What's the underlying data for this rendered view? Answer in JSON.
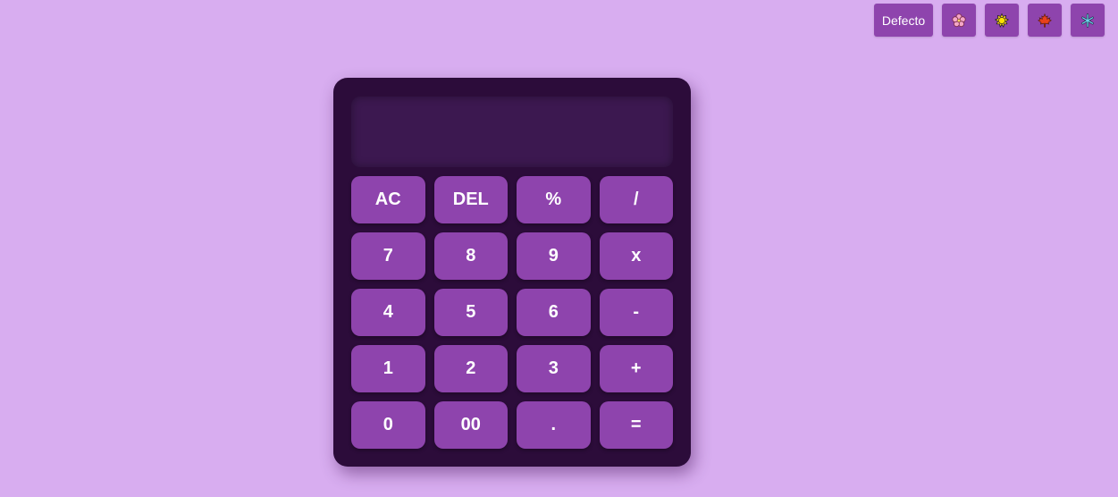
{
  "theme_bar": {
    "default_label": "Defecto",
    "themes": [
      {
        "icon": "flower-icon",
        "glyph": "🌸"
      },
      {
        "icon": "sun-icon",
        "glyph": "🌞"
      },
      {
        "icon": "maple-leaf-icon",
        "glyph": "🍁"
      },
      {
        "icon": "snowflake-icon",
        "glyph": "❄"
      }
    ]
  },
  "calculator": {
    "display": "",
    "keys": [
      {
        "label": "AC",
        "name": "clear-button"
      },
      {
        "label": "DEL",
        "name": "delete-button"
      },
      {
        "label": "%",
        "name": "percent-button"
      },
      {
        "label": "/",
        "name": "divide-button"
      },
      {
        "label": "7",
        "name": "digit-7-button"
      },
      {
        "label": "8",
        "name": "digit-8-button"
      },
      {
        "label": "9",
        "name": "digit-9-button"
      },
      {
        "label": "x",
        "name": "multiply-button"
      },
      {
        "label": "4",
        "name": "digit-4-button"
      },
      {
        "label": "5",
        "name": "digit-5-button"
      },
      {
        "label": "6",
        "name": "digit-6-button"
      },
      {
        "label": "-",
        "name": "subtract-button"
      },
      {
        "label": "1",
        "name": "digit-1-button"
      },
      {
        "label": "2",
        "name": "digit-2-button"
      },
      {
        "label": "3",
        "name": "digit-3-button"
      },
      {
        "label": "+",
        "name": "add-button"
      },
      {
        "label": "0",
        "name": "digit-0-button"
      },
      {
        "label": "00",
        "name": "double-zero-button"
      },
      {
        "label": ".",
        "name": "decimal-button"
      },
      {
        "label": "=",
        "name": "equals-button"
      }
    ]
  },
  "colors": {
    "background": "#d8adf0",
    "accent": "#8e44ad",
    "body": "#2c0c3a",
    "display": "#3c1850"
  }
}
